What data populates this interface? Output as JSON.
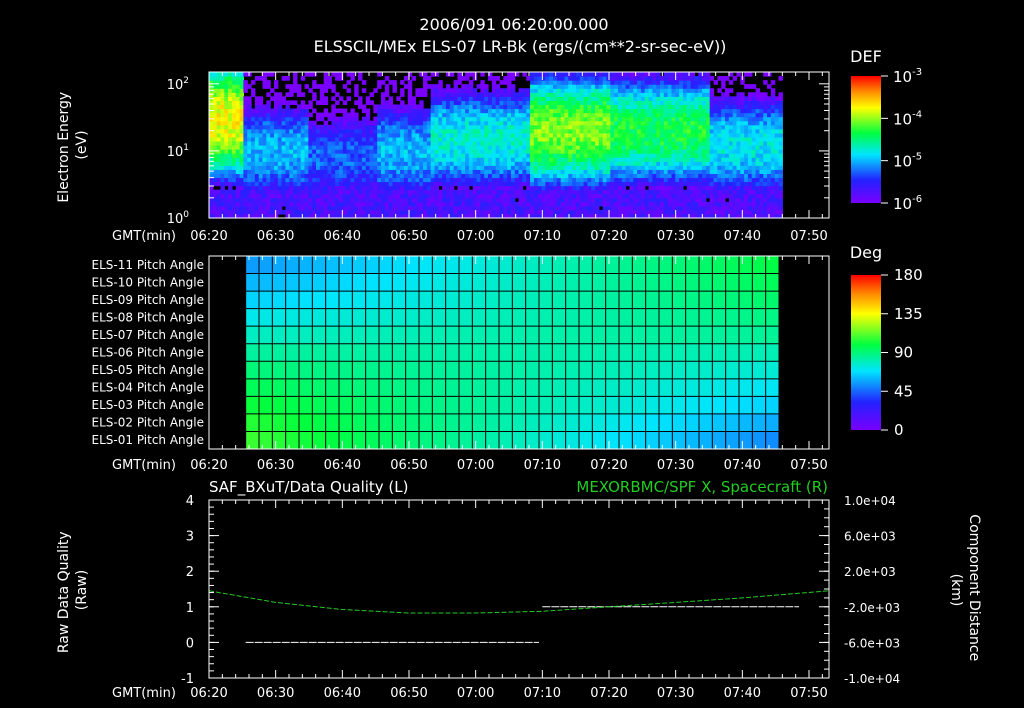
{
  "header": {
    "timestamp": "2006/091 06:20:00.000",
    "title": "ELSSCIL/MEx ELS-07 LR-Bk  (ergs/(cm**2-sr-sec-eV))"
  },
  "time_axis": {
    "label": "GMT(min)",
    "ticks": [
      "06:20",
      "06:30",
      "06:40",
      "06:50",
      "07:00",
      "07:10",
      "07:20",
      "07:30",
      "07:40",
      "07:50"
    ]
  },
  "chart_data": [
    {
      "type": "heatmap",
      "name": "spectrogram",
      "ylabel_line1": "Electron Energy",
      "ylabel_line2": "(eV)",
      "y_scale": "log",
      "ylim": [
        1,
        150
      ],
      "y_ticks": [
        {
          "value": 1,
          "base": "10",
          "exp": "0"
        },
        {
          "value": 10,
          "base": "10",
          "exp": "1"
        },
        {
          "value": 100,
          "base": "10",
          "exp": "2"
        }
      ],
      "xlim_minutes": [
        0,
        93
      ],
      "data_end_minute": 86,
      "colorbar": {
        "title": "DEF",
        "scale": "log",
        "range": [
          1e-06,
          0.001
        ],
        "ticks": [
          {
            "value": 1e-06,
            "base": "10",
            "exp": "-6"
          },
          {
            "value": 1e-05,
            "base": "10",
            "exp": "-5"
          },
          {
            "value": 0.0001,
            "base": "10",
            "exp": "-4"
          },
          {
            "value": 0.001,
            "base": "10",
            "exp": "-3"
          }
        ]
      },
      "features": [
        {
          "from_min": 0,
          "to_min": 5,
          "peak_energy_ev": 30,
          "level": 0.000237
        },
        {
          "from_min": 5,
          "to_min": 15,
          "peak_energy_ev": 10,
          "level": 1.2e-05
        },
        {
          "from_min": 15,
          "to_min": 25,
          "peak_energy_ev": 8,
          "level": 6e-06
        },
        {
          "from_min": 25,
          "to_min": 33,
          "peak_energy_ev": 10,
          "level": 1.2e-05
        },
        {
          "from_min": 33,
          "to_min": 48,
          "peak_energy_ev": 15,
          "level": 2.2e-05
        },
        {
          "from_min": 48,
          "to_min": 60,
          "peak_energy_ev": 20,
          "level": 0.000112
        },
        {
          "from_min": 60,
          "to_min": 75,
          "peak_energy_ev": 20,
          "level": 5.6e-05
        },
        {
          "from_min": 75,
          "to_min": 86,
          "peak_energy_ev": 12,
          "level": 1.8e-05
        }
      ]
    },
    {
      "type": "heatmap",
      "name": "pitch-angle",
      "rows": [
        "ELS-11 Pitch Angle",
        "ELS-10 Pitch Angle",
        "ELS-09 Pitch Angle",
        "ELS-08 Pitch Angle",
        "ELS-07 Pitch Angle",
        "ELS-06 Pitch Angle",
        "ELS-05 Pitch Angle",
        "ELS-04 Pitch Angle",
        "ELS-03 Pitch Angle",
        "ELS-02 Pitch Angle",
        "ELS-01 Pitch Angle"
      ],
      "xlim_minutes": [
        0,
        93
      ],
      "data_start_minute": 5.5,
      "bin_minutes": 2,
      "n_bins": 40,
      "colorbar": {
        "title": "Deg",
        "range": [
          0,
          180
        ],
        "ticks": [
          "180",
          "135",
          "90",
          "45",
          "0"
        ]
      },
      "values_deg_first_bin": [
        55,
        60,
        65,
        72,
        78,
        84,
        90,
        95,
        100,
        104,
        107
      ],
      "values_deg_last_bin": [
        98,
        95,
        92,
        88,
        85,
        80,
        75,
        70,
        65,
        58,
        52
      ]
    },
    {
      "type": "line",
      "name": "data-quality",
      "left_title": "SAF_BXuT/Data Quality (L)",
      "right_title": "MEXORBMC/SPF X, Spacecraft (R)",
      "left_ylabel_line1": "Raw Data Quality",
      "left_ylabel_line2": "(Raw)",
      "right_ylabel_line1": "Component Distance",
      "right_ylabel_line2": "(km)",
      "left_ylim": [
        -1,
        4
      ],
      "left_ticks": [
        "4",
        "3",
        "2",
        "1",
        "0",
        "-1"
      ],
      "right_ylim": [
        -10000,
        10000
      ],
      "right_ticks": [
        "1.0e+04",
        "6.0e+03",
        "2.0e+03",
        "-2.0e+03",
        "-6.0e+03",
        "-1.0e+04"
      ],
      "series": [
        {
          "name": "SAF_BXuT/Data Quality",
          "axis": "left",
          "color": "#ffffff",
          "segments": [
            {
              "x_minutes": [
                5.5,
                49.5
              ],
              "y": 0
            },
            {
              "x_minutes": [
                50,
                88.5
              ],
              "y": 1
            }
          ]
        },
        {
          "name": "MEXORBMC/SPF X, Spacecraft",
          "axis": "right",
          "color": "#22cc22",
          "x_minutes": [
            0,
            10,
            20,
            30,
            40,
            50,
            60,
            70,
            80,
            93
          ],
          "values_km": [
            -200,
            -1500,
            -2300,
            -2700,
            -2700,
            -2500,
            -2000,
            -1500,
            -1000,
            -200
          ]
        }
      ]
    }
  ]
}
